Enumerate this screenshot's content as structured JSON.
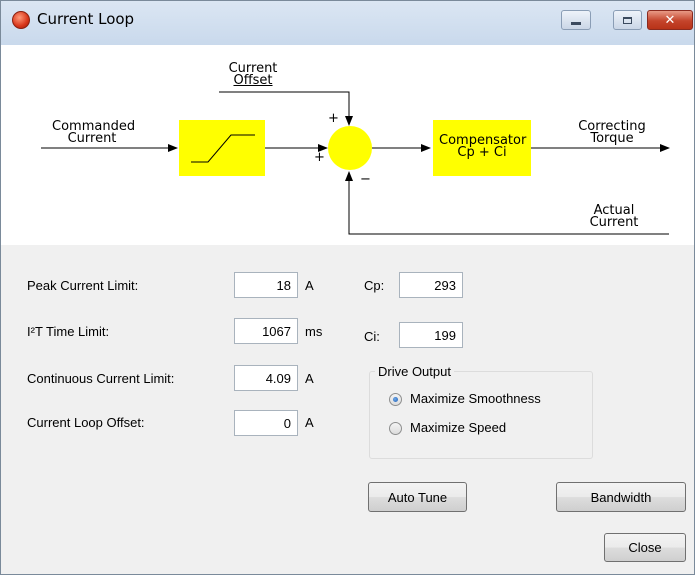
{
  "window": {
    "title": "Current Loop",
    "controls": {
      "minimize": "minimize",
      "maximize": "maximize",
      "close": "✕"
    }
  },
  "diagram": {
    "commanded_current_line1": "Commanded",
    "commanded_current_line2": "Current",
    "current_offset_line1": "Current",
    "current_offset_line2": "Offset",
    "compensator_line1": "Compensator",
    "compensator_line2": "Cp + Ci",
    "correcting_torque_line1": "Correcting",
    "correcting_torque_line2": "Torque",
    "actual_current_line1": "Actual",
    "actual_current_line2": "Current",
    "sign_offset": "+",
    "sign_input": "+",
    "sign_feedback": "−",
    "block_color": "#ffff00"
  },
  "limits": {
    "peak_current": {
      "label": "Peak Current Limit:",
      "value": "18",
      "unit": "A"
    },
    "i2t_time": {
      "label": "I²T Time Limit:",
      "value": "1067",
      "unit": "ms"
    },
    "continuous_current": {
      "label": "Continuous Current Limit:",
      "value": "4.09",
      "unit": "A"
    },
    "loop_offset": {
      "label": "Current Loop Offset:",
      "value": "0",
      "unit": "A"
    }
  },
  "gains": {
    "cp": {
      "label": "Cp:",
      "value": "293"
    },
    "ci": {
      "label": "Ci:",
      "value": "199"
    }
  },
  "drive_output": {
    "title": "Drive Output",
    "options": [
      {
        "label": "Maximize Smoothness",
        "selected": true
      },
      {
        "label": "Maximize Speed",
        "selected": false
      }
    ]
  },
  "buttons": {
    "auto_tune": "Auto Tune",
    "bandwidth": "Bandwidth",
    "close": "Close"
  }
}
